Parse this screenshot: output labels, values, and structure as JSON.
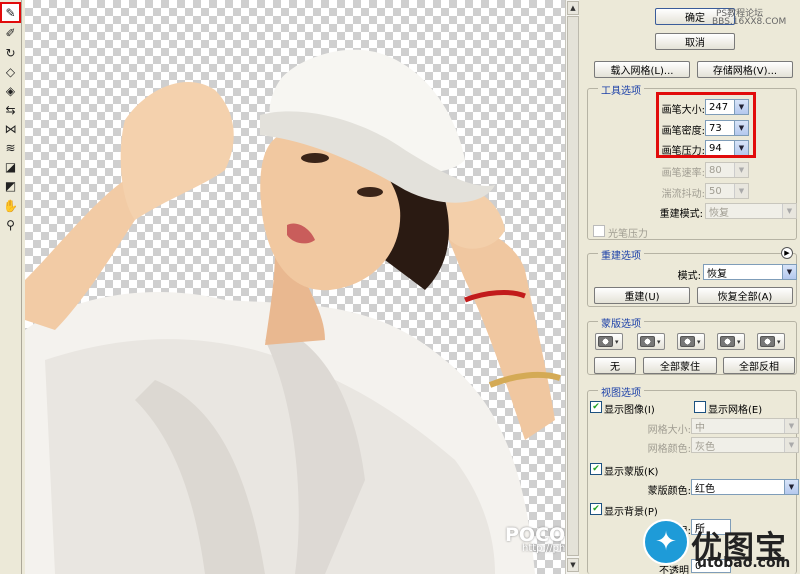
{
  "toolbar": {
    "tools": [
      {
        "name": "forward-warp-tool",
        "glyph": "✎",
        "active": true
      },
      {
        "name": "reconstruct-tool",
        "glyph": "✐",
        "active": false
      },
      {
        "name": "twirl-tool",
        "glyph": "↻",
        "active": false
      },
      {
        "name": "pucker-tool",
        "glyph": "◇",
        "active": false
      },
      {
        "name": "bloat-tool",
        "glyph": "◈",
        "active": false
      },
      {
        "name": "push-left-tool",
        "glyph": "⇆",
        "active": false
      },
      {
        "name": "mirror-tool",
        "glyph": "⋈",
        "active": false
      },
      {
        "name": "turbulence-tool",
        "glyph": "≋",
        "active": false
      },
      {
        "name": "freeze-mask-tool",
        "glyph": "◪",
        "active": false
      },
      {
        "name": "thaw-mask-tool",
        "glyph": "◩",
        "active": false
      },
      {
        "name": "hand-tool",
        "glyph": "✋",
        "active": false
      },
      {
        "name": "zoom-tool",
        "glyph": "⚲",
        "active": false
      }
    ]
  },
  "dialog": {
    "ok_label": "确定",
    "cancel_label": "取消",
    "load_mesh_label": "载入网格(L)...",
    "save_mesh_label": "存储网格(V)..."
  },
  "tool_options": {
    "title": "工具选项",
    "brush_size_label": "画笔大小:",
    "brush_size": "247",
    "brush_density_label": "画笔密度:",
    "brush_density": "73",
    "brush_pressure_label": "画笔压力:",
    "brush_pressure": "94",
    "brush_rate_label": "画笔速率:",
    "brush_rate": "80",
    "turbulent_jitter_label": "湍流抖动:",
    "turbulent_jitter": "50",
    "reconstruct_mode_label": "重建模式:",
    "reconstruct_mode": "恢复",
    "stylus_pressure_label": "光笔压力"
  },
  "reconstruct_options": {
    "title": "重建选项",
    "mode_label": "模式:",
    "mode": "恢复",
    "reconstruct_label": "重建(U)",
    "restore_all_label": "恢复全部(A)"
  },
  "mask_options": {
    "title": "蒙版选项",
    "none_label": "无",
    "mask_all_label": "全部蒙住",
    "invert_all_label": "全部反相"
  },
  "view_options": {
    "title": "视图选项",
    "show_image_label": "显示图像(I)",
    "show_image": true,
    "show_mesh_label": "显示网格(E)",
    "show_mesh": false,
    "mesh_size_label": "网格大小:",
    "mesh_size": "中",
    "mesh_color_label": "网格颜色:",
    "mesh_color": "灰色",
    "show_mask_label": "显示蒙版(K)",
    "show_mask": true,
    "mask_color_label": "蒙版颜色:",
    "mask_color": "红色",
    "show_backdrop_label": "显示背景(P)",
    "show_backdrop": true,
    "use_label": "使用:",
    "use_value": "所",
    "mode_partial_label": "不透明",
    "opacity_partial": "0"
  },
  "watermarks": {
    "top_site": "PS教程论坛",
    "top_url": "BBS.16XX8.COM",
    "poco": "POCO 摄影专题",
    "poco_url": "http://photo.poco.cn/",
    "brand": "优图宝",
    "brand_url": "utobao.com"
  }
}
